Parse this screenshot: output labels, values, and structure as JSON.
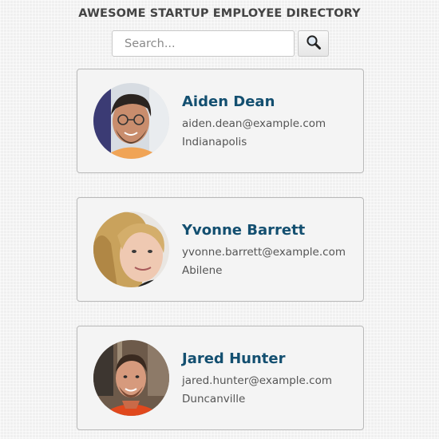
{
  "header": {
    "title": "AWESOME STARTUP EMPLOYEE DIRECTORY"
  },
  "search": {
    "placeholder": "Search...",
    "value": "",
    "button_icon": "magnifier-icon"
  },
  "employees": [
    {
      "name": "Aiden Dean",
      "email": "aiden.dean@example.com",
      "city": "Indianapolis"
    },
    {
      "name": "Yvonne Barrett",
      "email": "yvonne.barrett@example.com",
      "city": "Abilene"
    },
    {
      "name": "Jared Hunter",
      "email": "jared.hunter@example.com",
      "city": "Duncanville"
    }
  ],
  "colors": {
    "name_text": "#134f70",
    "card_background": "#f4f4f4",
    "card_border": "#b8b8b8"
  }
}
